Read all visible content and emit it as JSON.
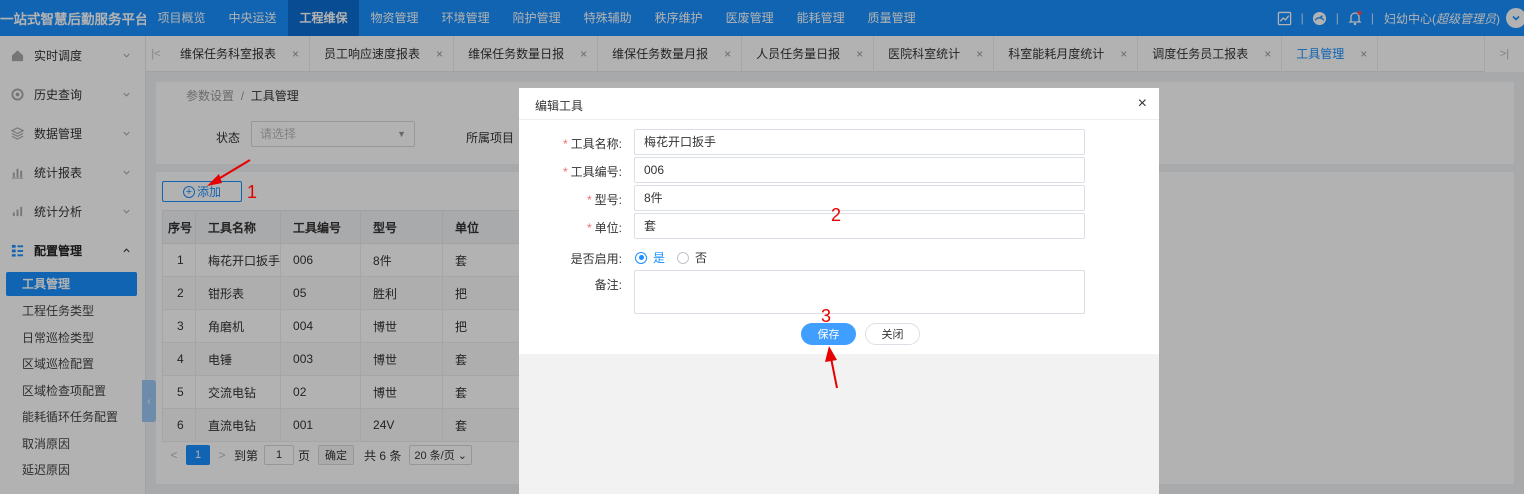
{
  "app": {
    "brand": "一站式智慧后勤服务平台",
    "top_nav": [
      "项目概览",
      "中央运送",
      "工程维保",
      "物资管理",
      "环境管理",
      "陪护管理",
      "特殊辅助",
      "秩序维护",
      "医废管理",
      "能耗管理",
      "质量管理"
    ],
    "active_top_nav": "工程维保",
    "user_prefix": "妇幼中心(",
    "user_role": "超级管理员",
    "user_suffix": ")",
    "sep": "|"
  },
  "sidebar": {
    "menus": [
      {
        "label": "实时调度",
        "icon": "home-icon"
      },
      {
        "label": "历史查询",
        "icon": "history-icon"
      },
      {
        "label": "数据管理",
        "icon": "layers-icon"
      },
      {
        "label": "统计报表",
        "icon": "bar-chart-icon"
      },
      {
        "label": "统计分析",
        "icon": "analysis-icon"
      },
      {
        "label": "配置管理",
        "icon": "grid-icon"
      }
    ],
    "sub_items": [
      "工具管理",
      "工程任务类型",
      "日常巡检类型",
      "区域巡检配置",
      "区域检查项配置",
      "能耗循环任务配置",
      "取消原因",
      "延迟原因"
    ]
  },
  "tabs": [
    {
      "label": "维保任务科室报表"
    },
    {
      "label": "员工响应速度报表"
    },
    {
      "label": "维保任务数量日报"
    },
    {
      "label": "维保任务数量月报"
    },
    {
      "label": "人员任务量日报"
    },
    {
      "label": "医院科室统计"
    },
    {
      "label": "科室能耗月度统计"
    },
    {
      "label": "调度任务员工报表"
    },
    {
      "label": "工具管理"
    }
  ],
  "tab_close": "×",
  "breadcrumb": {
    "parent": "参数设置",
    "sep": "/",
    "current": "工具管理"
  },
  "filter": {
    "status_label": "状态",
    "status_placeholder": "请选择",
    "project_label": "所属项目"
  },
  "toolbar": {
    "add_label": "添加"
  },
  "table": {
    "headers": [
      "序号",
      "工具名称",
      "工具编号",
      "型号",
      "单位"
    ],
    "rows": [
      [
        "1",
        "梅花开口扳手",
        "006",
        "8件",
        "套"
      ],
      [
        "2",
        "钳形表",
        "05",
        "胜利",
        "把"
      ],
      [
        "3",
        "角磨机",
        "004",
        "博世",
        "把"
      ],
      [
        "4",
        "电锤",
        "003",
        "博世",
        "套"
      ],
      [
        "5",
        "交流电钻",
        "02",
        "博世",
        "套"
      ],
      [
        "6",
        "直流电钻",
        "001",
        "24V",
        "套"
      ]
    ]
  },
  "pager": {
    "current_page": "1",
    "goto_label": "到第",
    "goto_value": "1",
    "page_unit": "页",
    "confirm_label": "确定",
    "total_label": "共 6 条",
    "page_size": "20 条/页"
  },
  "dialog": {
    "title": "编辑工具",
    "close": "×",
    "fields": [
      {
        "label": "工具名称:",
        "required": true,
        "value": "梅花开口扳手"
      },
      {
        "label": "工具编号:",
        "required": true,
        "value": "006"
      },
      {
        "label": "型号:",
        "required": true,
        "value": "8件"
      },
      {
        "label": "单位:",
        "required": true,
        "value": "套"
      }
    ],
    "enabled_label": "是否启用:",
    "enabled_yes": "是",
    "enabled_no": "否",
    "enabled_value": "是",
    "remark_label": "备注:",
    "remark_value": "",
    "save_label": "保存",
    "cancel_label": "关闭"
  },
  "annotations": {
    "step1": "1",
    "step2": "2",
    "step3": "3"
  },
  "colors": {
    "primary": "#1890ff",
    "annotation": "#e60000",
    "required": "#f56c6c"
  }
}
